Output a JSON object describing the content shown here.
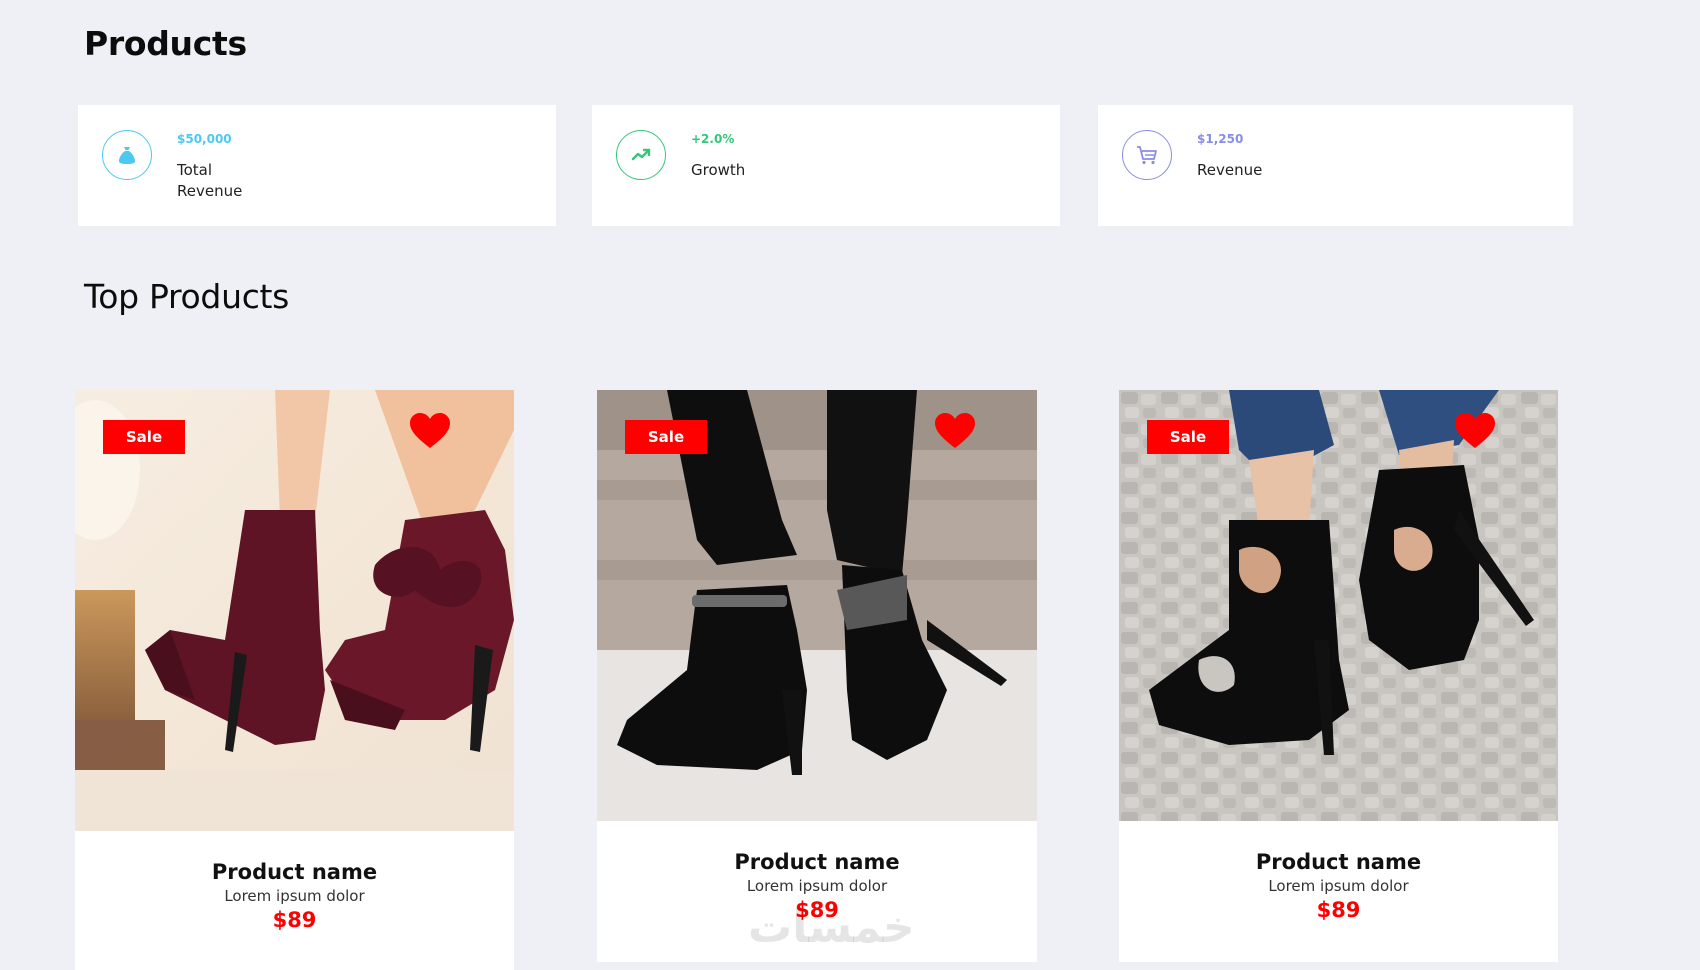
{
  "page": {
    "title": "Products",
    "section_title": "Top Products",
    "watermark": "خمسات"
  },
  "stats": [
    {
      "value": "$50,000",
      "label": "Total Revenue",
      "icon": "money-bag-icon",
      "color": "#4cc9f0"
    },
    {
      "value": "+2.0%",
      "label": "Growth",
      "icon": "trending-up-icon",
      "color": "#34c77b"
    },
    {
      "value": "$1,250",
      "label": "Revenue",
      "icon": "cart-icon",
      "color": "#8a8de8"
    }
  ],
  "products": [
    {
      "badge": "Sale",
      "name": "Product name",
      "description": "Lorem ipsum dolor",
      "price": "$89",
      "image": "burgundy-bow-ankle-boot-heels",
      "favorite_icon": "heart-icon"
    },
    {
      "badge": "Sale",
      "name": "Product name",
      "description": "Lorem ipsum dolor",
      "price": "$89",
      "image": "black-ankle-strap-pumps",
      "favorite_icon": "heart-icon"
    },
    {
      "badge": "Sale",
      "name": "Product name",
      "description": "Lorem ipsum dolor",
      "price": "$89",
      "image": "black-caged-platform-sandals",
      "favorite_icon": "heart-icon"
    }
  ],
  "colors": {
    "background": "#eff0f5",
    "sale_badge": "#ff0000",
    "price": "#ff0000",
    "heart": "#ff0000"
  }
}
